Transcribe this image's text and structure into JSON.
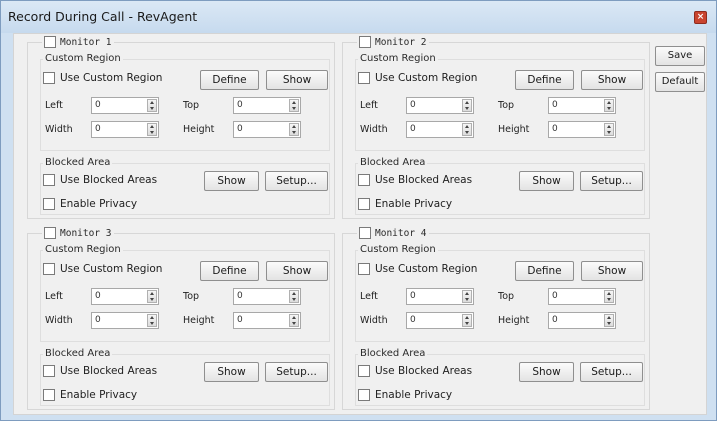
{
  "window": {
    "title": "Record During Call - RevAgent",
    "close_glyph": "×"
  },
  "side_buttons": {
    "save": "Save",
    "default": "Default"
  },
  "labels": {
    "custom_region": "Custom Region",
    "use_custom_region": "Use Custom Region",
    "define": "Define",
    "show": "Show",
    "left": "Left",
    "top": "Top",
    "width": "Width",
    "height": "Height",
    "blocked_area": "Blocked Area",
    "use_blocked_areas": "Use Blocked Areas",
    "setup": "Setup...",
    "enable_privacy": "Enable Privacy"
  },
  "monitors": [
    {
      "name": "Monitor 1",
      "enabled": false,
      "use_custom_region": false,
      "left": "0",
      "top": "0",
      "width": "0",
      "height": "0",
      "use_blocked_areas": false,
      "enable_privacy": false
    },
    {
      "name": "Monitor 2",
      "enabled": false,
      "use_custom_region": false,
      "left": "0",
      "top": "0",
      "width": "0",
      "height": "0",
      "use_blocked_areas": false,
      "enable_privacy": false
    },
    {
      "name": "Monitor 3",
      "enabled": false,
      "use_custom_region": false,
      "left": "0",
      "top": "0",
      "width": "0",
      "height": "0",
      "use_blocked_areas": false,
      "enable_privacy": false
    },
    {
      "name": "Monitor 4",
      "enabled": false,
      "use_custom_region": false,
      "left": "0",
      "top": "0",
      "width": "0",
      "height": "0",
      "use_blocked_areas": false,
      "enable_privacy": false
    }
  ],
  "colors": {
    "titlebar": "#cfe0f1",
    "close_button": "#c9442f",
    "client_bg": "#f0f0f0"
  }
}
